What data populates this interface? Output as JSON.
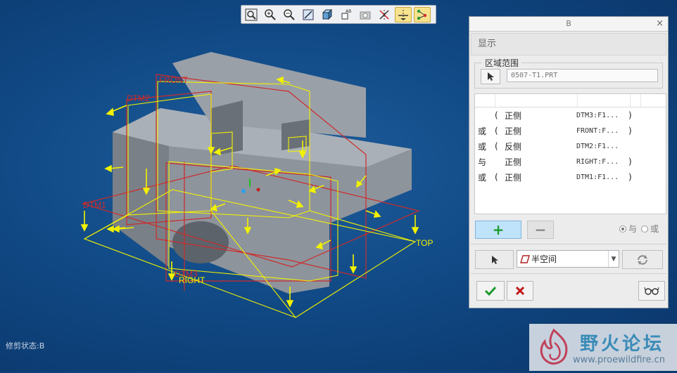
{
  "viewport": {
    "datum_labels": {
      "front": "FRONT",
      "dtm2": "DTM2",
      "dtm1": "DTM1",
      "dtm3": "DTM3",
      "top": "TOP",
      "right": "RIGHT"
    },
    "status_text": "修剪状态:B"
  },
  "toolbar": {
    "icons": [
      "zoom-fit-icon",
      "zoom-in-icon",
      "zoom-out-icon",
      "repaint-icon",
      "display-style-icon",
      "named-view-icon",
      "saved-orientation-icon",
      "datum-display-icon",
      "axis-display-icon",
      "point-display-icon"
    ]
  },
  "dialog": {
    "title": "B",
    "close_glyph": "×",
    "section": "显示",
    "scope_legend": "区域范围",
    "reference_value": "0507-T1.PRT",
    "rows": [
      {
        "op": "",
        "paren": "(",
        "side": "正侧",
        "ref": "DTM3:F1...",
        "close": ")"
      },
      {
        "op": "或",
        "paren": "(",
        "side": "正侧",
        "ref": "FRONT:F...",
        "close": ")"
      },
      {
        "op": "或",
        "paren": "(",
        "side": "反侧",
        "ref": "DTM2:F1...",
        "close": ""
      },
      {
        "op": "与",
        "paren": "",
        "side": "正侧",
        "ref": "RIGHT:F...",
        "close": ")"
      },
      {
        "op": "或",
        "paren": "(",
        "side": "正侧",
        "ref": "DTM1:F1...",
        "close": ")"
      }
    ],
    "add_label": "+",
    "remove_label": "−",
    "radio_and": "与",
    "radio_or": "或",
    "combo_value": "半空间"
  },
  "watermark": {
    "cn": "野火论坛",
    "url": "www.proewildfire.cn"
  },
  "colors": {
    "background": "#114a86",
    "datum_red": "#cc2b2b",
    "highlight_yellow": "#f2f200",
    "part_gray": "#8e949c"
  }
}
